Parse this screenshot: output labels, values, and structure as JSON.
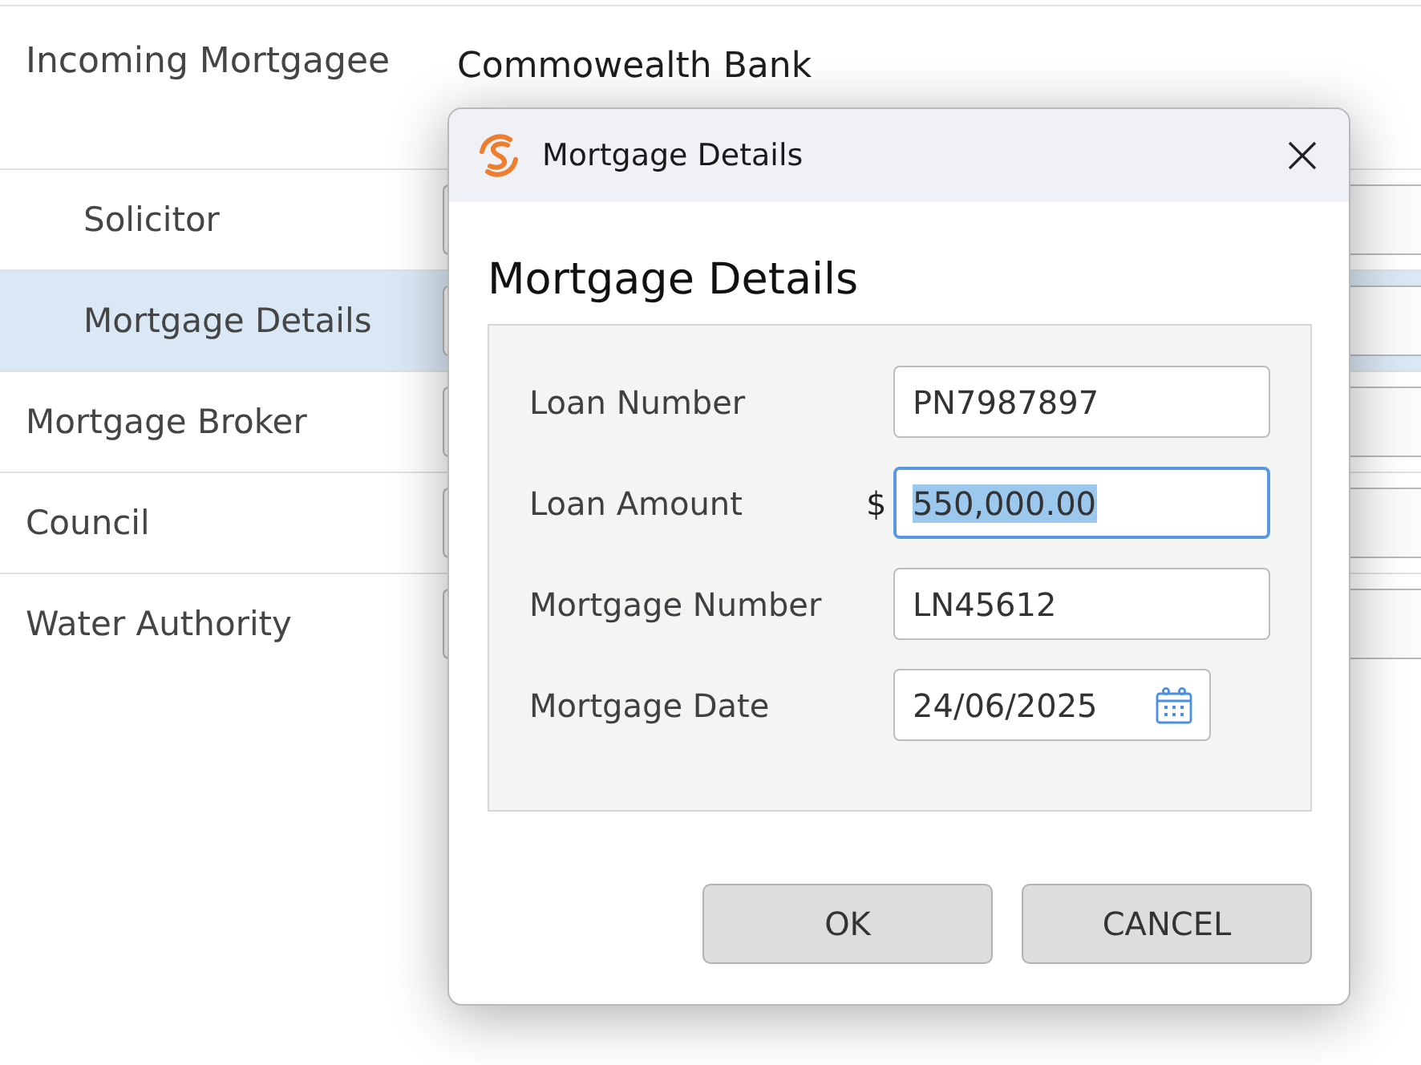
{
  "background": {
    "rows": [
      {
        "label": "Incoming Mortgagee",
        "kind": "value",
        "value": "Commowealth Bank",
        "selected": false,
        "children": [
          {
            "label": "Solicitor",
            "kind": "field",
            "selected": false
          },
          {
            "label": "Mortgage Details",
            "kind": "field",
            "selected": true
          }
        ]
      },
      {
        "label": "Mortgage Broker",
        "kind": "field",
        "selected": false
      },
      {
        "label": "Council",
        "kind": "field",
        "selected": false
      },
      {
        "label": "Water Authority",
        "kind": "field",
        "selected": false
      }
    ]
  },
  "dialog": {
    "title": "Mortgage Details",
    "heading": "Mortgage Details",
    "fields": [
      {
        "label": "Loan Number",
        "kind": "text",
        "value": "PN7987897",
        "focused": false
      },
      {
        "label": "Loan Amount",
        "kind": "text",
        "prefix": "$",
        "value": "550,000.00",
        "focused": true
      },
      {
        "label": "Mortgage Number",
        "kind": "text",
        "value": "LN45612",
        "focused": false
      },
      {
        "label": "Mortgage Date",
        "kind": "date",
        "value": "24/06/2025",
        "focused": false
      }
    ],
    "buttons": [
      "OK",
      "CANCEL"
    ]
  }
}
